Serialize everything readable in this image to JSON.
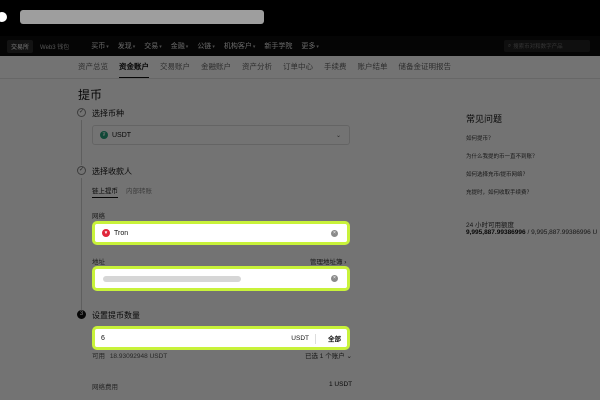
{
  "nav": {
    "mode_tabs": [
      "交易所",
      "Web3 钱包"
    ],
    "items": [
      {
        "label": "买币",
        "caret": true
      },
      {
        "label": "发现",
        "caret": true
      },
      {
        "label": "交易",
        "caret": true
      },
      {
        "label": "金融",
        "caret": true
      },
      {
        "label": "公链",
        "caret": true
      },
      {
        "label": "机构客户",
        "caret": true
      },
      {
        "label": "新手学院",
        "caret": false
      },
      {
        "label": "更多",
        "caret": true
      }
    ],
    "search_placeholder": "搜索币对和数字产品"
  },
  "sub_tabs": [
    "资产总览",
    "资金账户",
    "交易账户",
    "金融账户",
    "资产分析",
    "订单中心",
    "手续费",
    "账户结单",
    "储备金证明报告"
  ],
  "active_sub_tab": 1,
  "page_title": "提币",
  "steps": {
    "select_coin": "选择币种",
    "select_recipient": "选择收款人",
    "amount": "设置提币数量"
  },
  "coin": {
    "symbol": "USDT"
  },
  "recipient_tabs": [
    "链上提币",
    "内部转账"
  ],
  "network": {
    "label": "网络",
    "value": "Tron"
  },
  "address": {
    "label": "地址",
    "manage_link": "管理地址簿 ›"
  },
  "amount": {
    "value": "6",
    "unit": "USDT",
    "max_label": "全部",
    "available_label": "可用",
    "available_value": "18.93092948 USDT",
    "selected_accounts": "已选 1 个账户 ⌄"
  },
  "fee": {
    "label": "网络费用",
    "value": "1 USDT"
  },
  "faq": {
    "title": "常见问题",
    "links": [
      "如何提币？",
      "为什么我提的币一直不到账？",
      "如何选择充币/提币网络？",
      "充提时，如何收取手续费？"
    ]
  },
  "limit": {
    "label": "24 小时可用额度",
    "value": "9,995,887.99386996",
    "total": "/ 9,995,887.99386996 U"
  },
  "colors": {
    "highlight": "#c8f23a",
    "usdt": "#26a17b",
    "tron": "#e0263b"
  }
}
